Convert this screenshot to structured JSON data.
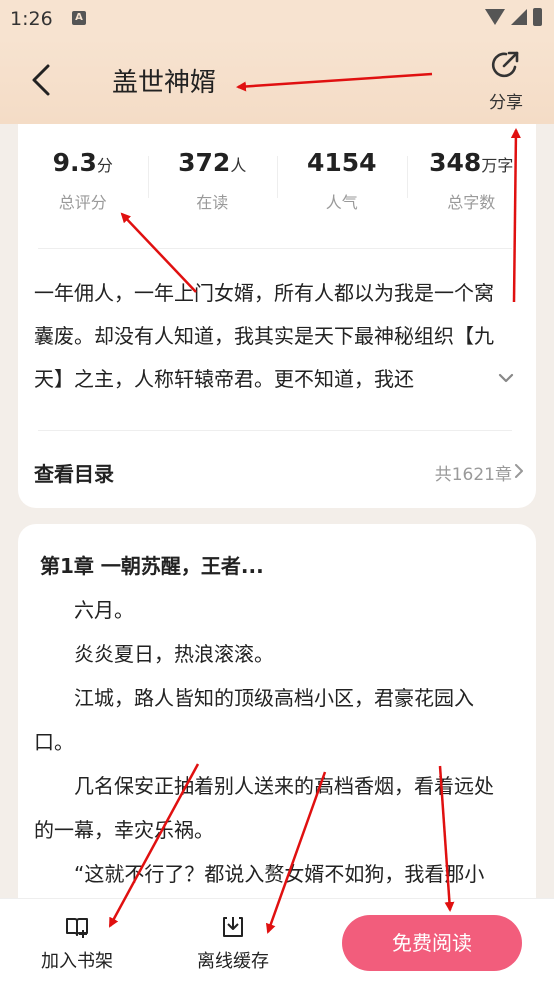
{
  "status_bar": {
    "time": "1:26",
    "notification_glyph": "A"
  },
  "header": {
    "title": "盖世神婿",
    "share_label": "分享"
  },
  "stats": [
    {
      "value": "9.3",
      "unit": "分",
      "label": "总评分"
    },
    {
      "value": "372",
      "unit": "人",
      "label": "在读"
    },
    {
      "value": "4154",
      "unit": "",
      "label": "人气"
    },
    {
      "value": "348",
      "unit": "万字",
      "label": "总字数"
    }
  ],
  "synopsis": "一年佣人，一年上门女婿，所有人都以为我是一个窝囊废。却没有人知道，我其实是天下最神秘组织【九天】之主，人称轩辕帝君。更不知道，我还",
  "catalog": {
    "title": "查看目录",
    "count": "共1621章"
  },
  "chapter": {
    "title": "第1章  一朝苏醒，王者...",
    "paragraphs": [
      "六月。",
      "炎炎夏日，热浪滚滚。",
      "江城，路人皆知的顶级高档小区，君豪花园入口。",
      "几名保安正抽着别人送来的高档香烟，看着远处的一幕，幸灾乐祸。",
      "“这就不行了？都说入赘女婿不如狗，我看那小"
    ]
  },
  "bottom_bar": {
    "shelf_label": "加入书架",
    "cache_label": "离线缓存",
    "read_label": "免费阅读"
  },
  "colors": {
    "header_bg": "#f7e3d0",
    "accent": "#f25d7c",
    "annotation": "#e01010"
  }
}
